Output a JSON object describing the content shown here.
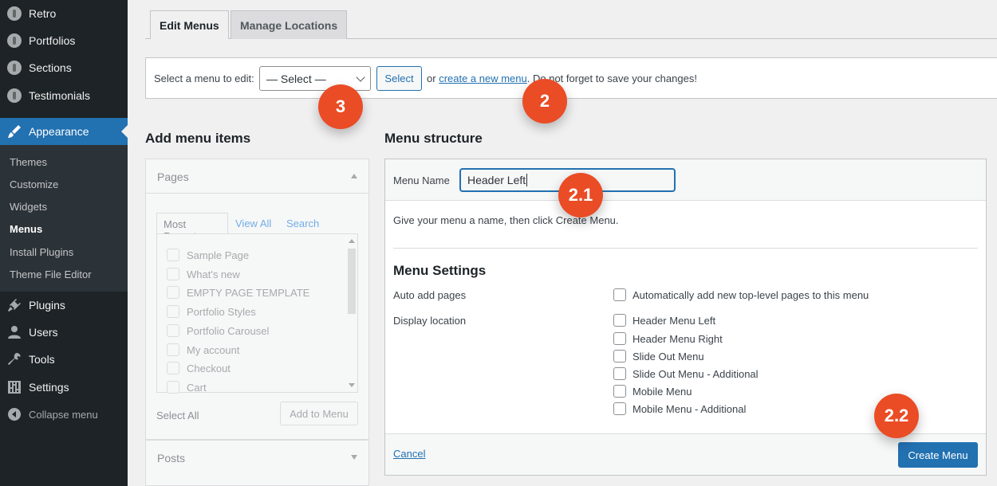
{
  "sidebar": {
    "top_items": [
      "Retro",
      "Portfolios",
      "Sections",
      "Testimonials"
    ],
    "active_item": "Appearance",
    "submenu": [
      "Themes",
      "Customize",
      "Widgets",
      "Menus",
      "Install Plugins",
      "Theme File Editor"
    ],
    "bottom_items": [
      "Plugins",
      "Users",
      "Tools",
      "Settings"
    ],
    "collapse": "Collapse menu"
  },
  "tabs": {
    "edit": "Edit Menus",
    "manage": "Manage Locations"
  },
  "select_bar": {
    "label": "Select a menu to edit:",
    "select_value": "— Select —",
    "select_button": "Select",
    "or_text": "or",
    "create_link": "create a new menu",
    "trail_text": ". Do not forget to save your changes!"
  },
  "left": {
    "heading": "Add menu items",
    "pages_title": "Pages",
    "subtabs": [
      "Most Recent",
      "View All",
      "Search"
    ],
    "pages": [
      "Sample Page",
      "What's new",
      "EMPTY PAGE TEMPLATE",
      "Portfolio Styles",
      "Portfolio Carousel",
      "My account",
      "Checkout",
      "Cart"
    ],
    "select_all": "Select All",
    "add_button": "Add to Menu",
    "posts_title": "Posts"
  },
  "right": {
    "heading": "Menu structure",
    "menu_name_label": "Menu Name",
    "menu_name_value": "Header Left",
    "hint": "Give your menu a name, then click Create Menu.",
    "settings_title": "Menu Settings",
    "auto_add_label": "Auto add pages",
    "auto_add_option": "Automatically add new top-level pages to this menu",
    "display_location_label": "Display location",
    "locations": [
      "Header Menu Left",
      "Header Menu Right",
      "Slide Out Menu",
      "Slide Out Menu - Additional",
      "Mobile Menu",
      "Mobile Menu - Additional"
    ],
    "cancel": "Cancel",
    "create_button": "Create Menu"
  },
  "callouts": [
    "3",
    "2",
    "2.1",
    "2.2"
  ],
  "colors": {
    "accent": "#2271b1",
    "sidebar": "#1d2327",
    "badge": "#ea4c26"
  }
}
